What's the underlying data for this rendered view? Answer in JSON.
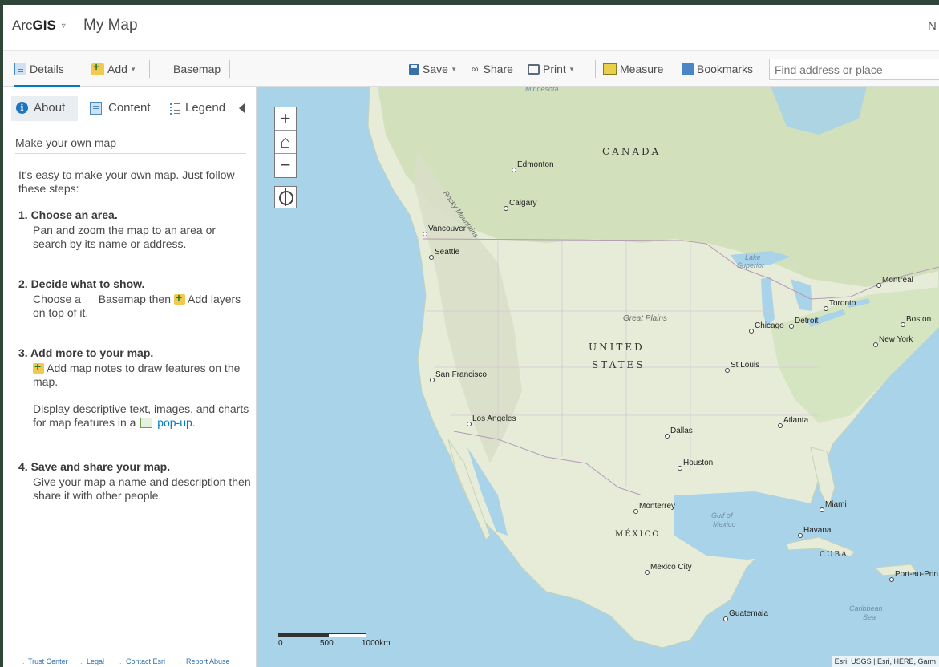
{
  "header": {
    "brand_prefix": "Arc",
    "brand_bold": "GIS",
    "brand_caret": "▿",
    "map_title": "My Map",
    "right_text": "N"
  },
  "toolbar": {
    "details": "Details",
    "add": "Add",
    "basemap": "Basemap",
    "save": "Save",
    "share": "Share",
    "print": "Print",
    "measure": "Measure",
    "bookmarks": "Bookmarks",
    "search_placeholder": "Find address or place",
    "caret": "▾"
  },
  "panel": {
    "tabs": {
      "about": "About",
      "content": "Content",
      "legend": "Legend"
    },
    "section_title": "Make your own map",
    "intro": "It's easy to make your own map. Just follow these steps:",
    "steps": [
      {
        "title": "1. Choose an area.",
        "body": "Pan and zoom the map to an area or search by its name or address."
      },
      {
        "title": "2. Decide what to show.",
        "body_a": "Choose a",
        "body_b": "Basemap then",
        "body_c": "Add layers on top of it."
      },
      {
        "title": "3. Add more to your map.",
        "body": "Add map notes to draw features on the map.",
        "body2_a": "Display descriptive text, images, and charts for map features in a",
        "body2_link": "pop-up."
      },
      {
        "title": "4. Save and share your map.",
        "body": "Give your map a name and description then share it with other people."
      }
    ],
    "footer": {
      "trust": "Trust Center",
      "legal": "Legal",
      "contact": "Contact Esri",
      "report": "Report Abuse",
      "dot": "."
    }
  },
  "map": {
    "zoom_in": "+",
    "home": "⌂",
    "zoom_out": "−",
    "countries": {
      "canada": "CANADA",
      "united": "UNITED",
      "states": "STATES",
      "mexico": "MÉXICO",
      "cuba": "CUBA"
    },
    "terrain": {
      "rocky": "Rocky Mountains",
      "great_plains": "Great Plains"
    },
    "water": {
      "lake": "Lake",
      "superior": "Superior",
      "gulf": "Gulf of",
      "gulf2": "Mexico",
      "caribbean": "Caribbean",
      "sea": "Sea",
      "minnesota": "Minnesota"
    },
    "cities": {
      "edmonton": "Edmonton",
      "calgary": "Calgary",
      "vancouver": "Vancouver",
      "seattle": "Seattle",
      "montreal": "Montreal",
      "toronto": "Toronto",
      "boston": "Boston",
      "newyork": "New York",
      "chicago": "Chicago",
      "detroit": "Detroit",
      "stlouis": "St Louis",
      "sanfrancisco": "San Francisco",
      "losangeles": "Los Angeles",
      "atlanta": "Atlanta",
      "dallas": "Dallas",
      "houston": "Houston",
      "monterrey": "Monterrey",
      "miami": "Miami",
      "havana": "Havana",
      "mexicocity": "Mexico City",
      "portauprince": "Port-au-Prin",
      "guatemala": "Guatemala"
    },
    "scale": {
      "zero": "0",
      "mid": "500",
      "end": "1000km"
    },
    "attribution": "Esri, USGS | Esri, HERE, Garm"
  },
  "colors": {
    "accent": "#0079c1",
    "water": "#a9d3e8",
    "land": "#e4ecd6",
    "forest": "#c8dcb0",
    "frame": "#2f4538"
  }
}
